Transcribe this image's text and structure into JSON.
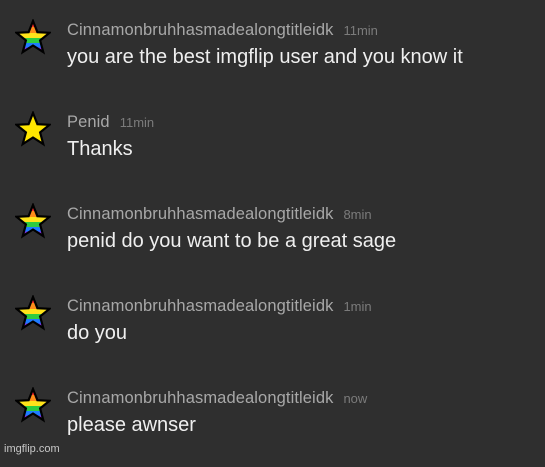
{
  "messages": [
    {
      "avatar_icon": "rainbow-star-icon",
      "username": "Cinnamonbruhhasmadealongtitleidk",
      "time": "11min",
      "text": "you are the best imgflip user and you know it"
    },
    {
      "avatar_icon": "yellow-star-icon",
      "username": "Penid",
      "time": "11min",
      "text": "Thanks"
    },
    {
      "avatar_icon": "rainbow-star-icon",
      "username": "Cinnamonbruhhasmadealongtitleidk",
      "time": "8min",
      "text": "penid do you want to be a great sage"
    },
    {
      "avatar_icon": "rainbow-star-icon",
      "username": "Cinnamonbruhhasmadealongtitleidk",
      "time": "1min",
      "text": "do you"
    },
    {
      "avatar_icon": "rainbow-star-icon",
      "username": "Cinnamonbruhhasmadealongtitleidk",
      "time": "now",
      "text": "please awnser"
    }
  ],
  "watermark": "imgflip.com",
  "colors": {
    "background": "#2f2f2f",
    "username": "#a8a8a8",
    "time": "#7b7b7b",
    "text": "#efefef",
    "yellow_star": "#ffe600",
    "star_outline": "#000000"
  }
}
